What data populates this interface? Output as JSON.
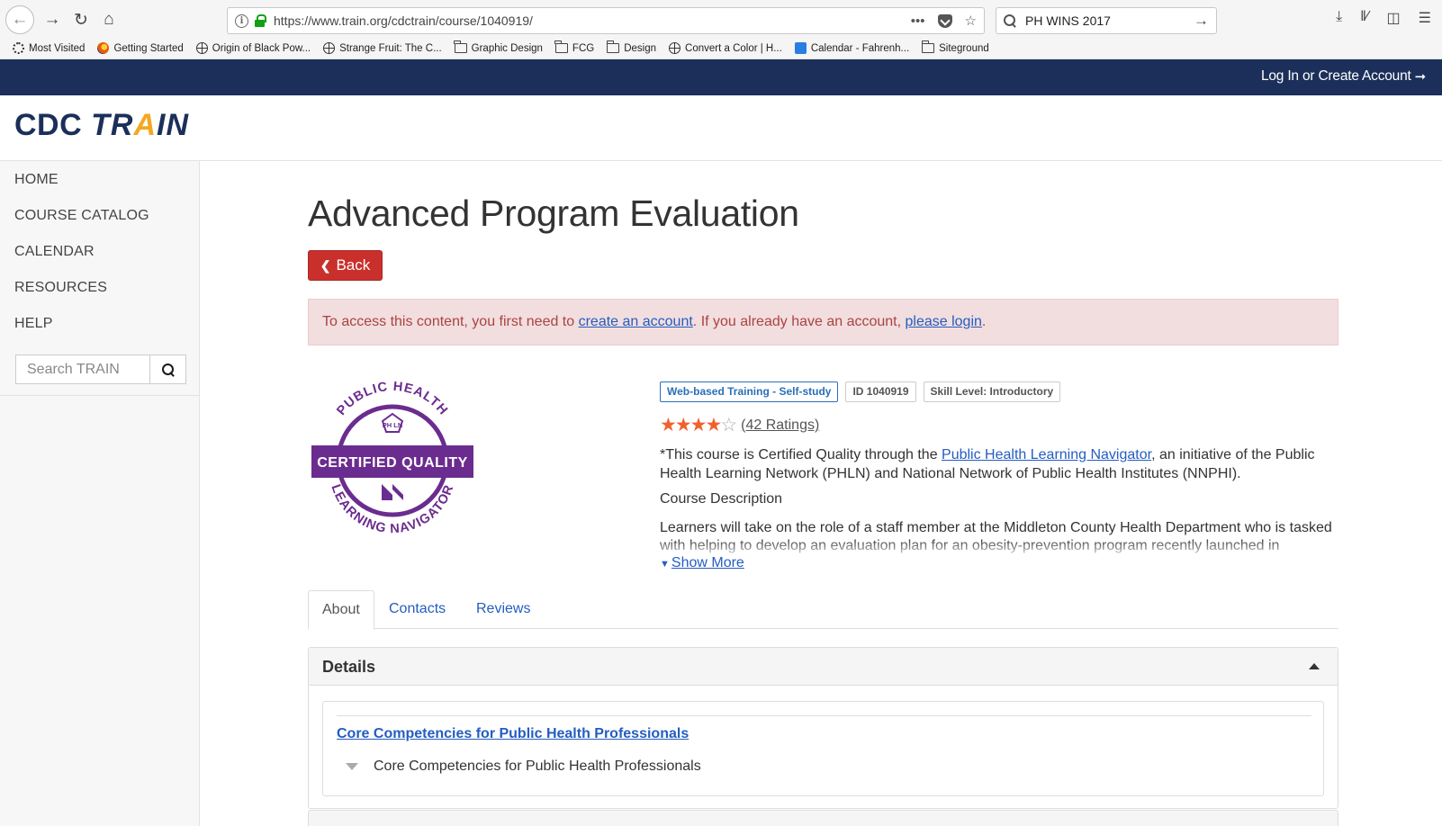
{
  "browser": {
    "url": "https://www.train.org/cdctrain/course/1040919/",
    "search_query": "PH WINS 2017",
    "bookmarks": [
      {
        "label": "Most Visited",
        "icon": "gear"
      },
      {
        "label": "Getting Started",
        "icon": "firefox"
      },
      {
        "label": "Origin of Black Pow...",
        "icon": "globe"
      },
      {
        "label": "Strange Fruit: The C...",
        "icon": "globe"
      },
      {
        "label": "Graphic Design",
        "icon": "folder"
      },
      {
        "label": "FCG",
        "icon": "folder"
      },
      {
        "label": "Design",
        "icon": "folder"
      },
      {
        "label": "Convert a Color | H...",
        "icon": "globe"
      },
      {
        "label": "Calendar - Fahrenh...",
        "icon": "calendar"
      },
      {
        "label": "Siteground",
        "icon": "folder"
      }
    ]
  },
  "site": {
    "login_label": "Log In or Create Account",
    "brand_cdc": "CDC",
    "brand_tr": "TR",
    "brand_a": "A",
    "brand_in": "IN"
  },
  "sidebar": {
    "items": [
      {
        "label": "HOME"
      },
      {
        "label": "COURSE CATALOG"
      },
      {
        "label": "CALENDAR"
      },
      {
        "label": "RESOURCES"
      },
      {
        "label": "HELP"
      }
    ],
    "search_placeholder": "Search TRAIN"
  },
  "course": {
    "title": "Advanced Program Evaluation",
    "back_label": "Back",
    "alert": {
      "prefix": "To access this content, you first need to ",
      "create_link": "create an account",
      "middle": ". If you already have an account, ",
      "login_link": "please login",
      "suffix": "."
    },
    "badge": {
      "top_text": "PUBLIC HEALTH",
      "center_text": "CERTIFIED QUALITY",
      "bottom_text": "LEARNING NAVIGATOR",
      "monogram": "PH LN",
      "color": "#6b2c8f"
    },
    "tags": [
      "Web-based Training - Self-study",
      "ID 1040919",
      "Skill Level: Introductory"
    ],
    "rating_stars": 4,
    "rating_max": 5,
    "ratings_label": "(42 Ratings)",
    "certified_text_prefix": "*This course is Certified Quality through the ",
    "certified_link": "Public Health Learning Navigator",
    "certified_text_suffix": ", an initiative of the Public Health Learning Network (PHLN) and National Network of Public Health Institutes (NNPHI).",
    "description_heading": "Course Description",
    "description_body": "Learners will take on the role of a staff member at the Middleton County Health Department who is tasked with helping to develop an evaluation plan for an obesity-prevention program recently launched in",
    "show_more": "Show More"
  },
  "tabs": [
    {
      "label": "About",
      "active": true
    },
    {
      "label": "Contacts",
      "active": false
    },
    {
      "label": "Reviews",
      "active": false
    }
  ],
  "details": {
    "heading": "Details",
    "competency_link": "Core Competencies for Public Health Professionals",
    "competency_item": "Core Competencies for Public Health Professionals"
  },
  "colors": {
    "navy": "#1b2f5a",
    "accent_yellow": "#f3a823",
    "danger": "#c9302c",
    "link": "#245dc1",
    "star": "#f0622d"
  }
}
